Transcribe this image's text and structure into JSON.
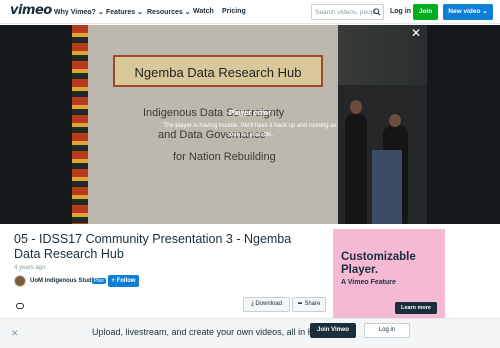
{
  "header": {
    "logo": "vimeo",
    "nav": [
      "Why Vimeo?",
      "Features",
      "Resources",
      "Watch",
      "Pricing"
    ],
    "search_placeholder": "Search videos, peopl",
    "login": "Log in",
    "join": "Join",
    "new_video": "New video"
  },
  "player": {
    "slide_title": "Ngemba Data Research Hub",
    "slide_lines": [
      "Indigenous Data Sovereignty",
      "and Data Governance",
      "for Nation Rebuilding"
    ],
    "error_title": "Player error",
    "error_message": "The player is having trouble. We'll have it back up and running as soon as possible."
  },
  "video": {
    "title": "05 - IDSS17 Community Presentation 3 - Ngemba Data Research Hub",
    "age": "4 years ago",
    "uploader": "UoM Indigenous Studies",
    "plus_badge": "Plus",
    "follow": "+ Follow",
    "download": "Download",
    "share": "Share"
  },
  "ad": {
    "headline": "Customizable Player.",
    "subline": "A Vimeo Feature",
    "cta": "Learn more"
  },
  "banner": {
    "text": "Upload, livestream, and create your own videos, all in HD.",
    "join": "Join Vimeo",
    "login": "Log in"
  },
  "colors": {
    "brand": "#1a2e3b",
    "join_green": "#00ad1e",
    "primary_blue": "#0f7fd6",
    "ad_pink": "#f6b9d4"
  }
}
